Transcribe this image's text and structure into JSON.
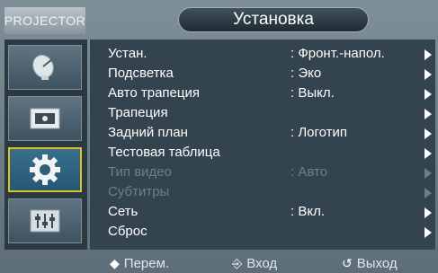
{
  "header": {
    "brand": "PROJECTOR",
    "title": "Установка"
  },
  "sidebar": {
    "tiles": [
      {
        "icon": "satellite-dish-icon",
        "active": false
      },
      {
        "icon": "picture-frame-icon",
        "active": false
      },
      {
        "icon": "gear-icon",
        "active": true
      },
      {
        "icon": "sliders-icon",
        "active": false
      }
    ]
  },
  "menu": {
    "items": [
      {
        "label": "Устан.",
        "value": ": Фронт.-напол.",
        "enabled": true
      },
      {
        "label": "Подсветка",
        "value": ": Эко",
        "enabled": true
      },
      {
        "label": "Авто трапеция",
        "value": ": Выкл.",
        "enabled": true
      },
      {
        "label": "Трапеция",
        "value": "",
        "enabled": true
      },
      {
        "label": "Задний план",
        "value": ": Логотип",
        "enabled": true
      },
      {
        "label": "Тестовая таблица",
        "value": "",
        "enabled": true
      },
      {
        "label": "Тип видео",
        "value": ": Авто",
        "enabled": false
      },
      {
        "label": "Субтитры",
        "value": "",
        "enabled": false
      },
      {
        "label": "Сеть",
        "value": ": Вкл.",
        "enabled": true
      },
      {
        "label": "Сброс",
        "value": "",
        "enabled": true
      }
    ]
  },
  "footer": {
    "move_glyph": "◆",
    "move_label": "Перем.",
    "enter_glyph": "⎆",
    "enter_label": "Вход",
    "exit_glyph": "↺",
    "exit_label": "Выход"
  },
  "colors": {
    "accent_border": "#d9c22a",
    "menu_background": "#34444e",
    "disabled_text": "#6f7f88"
  }
}
